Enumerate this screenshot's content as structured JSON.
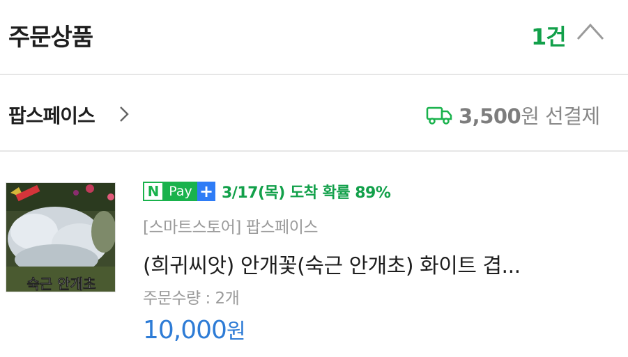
{
  "header": {
    "title": "주문상품",
    "count": "1건"
  },
  "seller": {
    "name": "팝스페이스",
    "shipping_fee": "3,500",
    "shipping_unit": "원 선결제"
  },
  "product": {
    "npay_n": "N",
    "npay_pay": "Pay",
    "npay_plus": "+",
    "delivery_eta": "3/17(목) 도착 확률 89%",
    "store": "[스마트스토어] 팝스페이스",
    "name": "(희귀씨앗) 안개꽃(숙근 안개초) 화이트 겹...",
    "quantity": "주문수량 : 2개",
    "price": "10,000",
    "price_unit": "원",
    "image_caption": "숙근 안개초"
  },
  "colors": {
    "accent_green": "#12a04a",
    "price_blue": "#2e7cd6",
    "npay_green": "#19b24c",
    "npay_blue": "#2e7cf6"
  }
}
